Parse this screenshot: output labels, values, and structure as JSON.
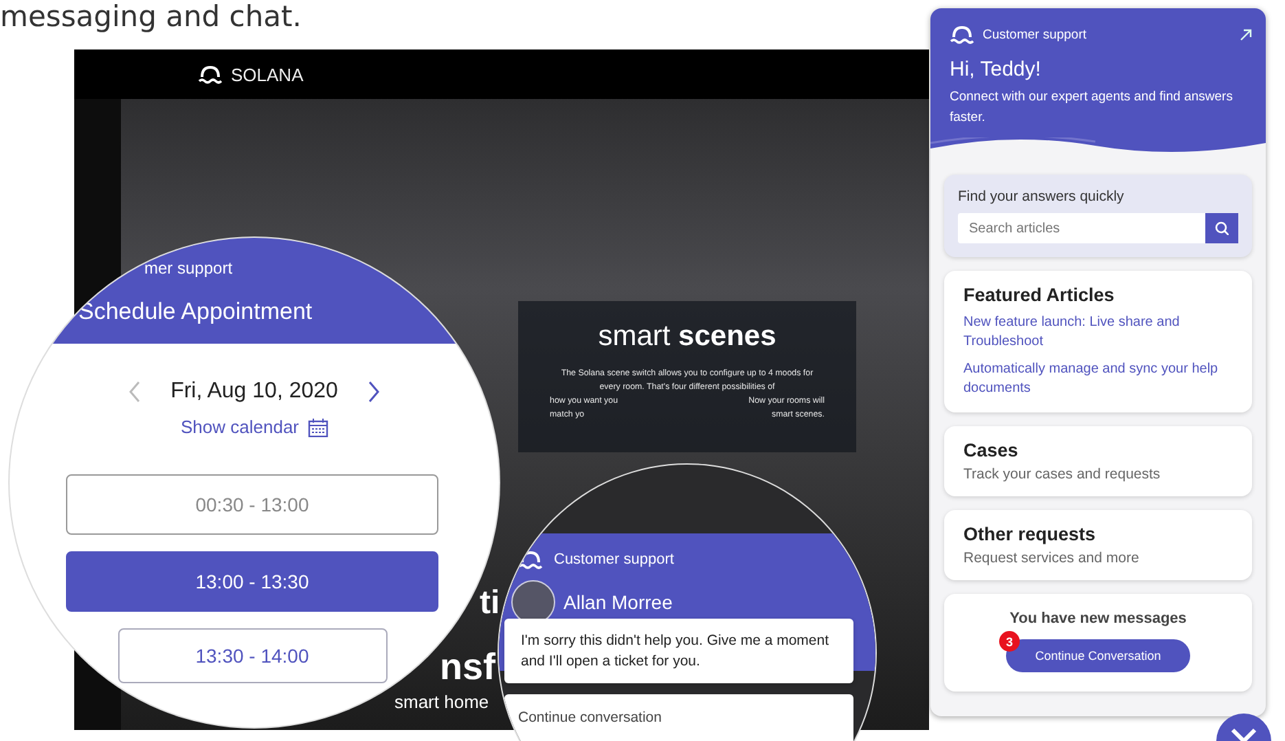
{
  "intro": {
    "text": "messaging and chat."
  },
  "site": {
    "brand": "SOLANA",
    "feature": {
      "title_light": "smart",
      "title_bold": "scenes",
      "text": "The Solana scene switch allows you to configure up to 4 moods for every room. That's four different possibilities of",
      "fragments": [
        [
          "how you want you",
          "Now your rooms will"
        ],
        [
          "match yo",
          "smart scenes."
        ]
      ]
    },
    "hero_fragments": [
      "ti",
      "nsf",
      "smart home"
    ]
  },
  "schedule": {
    "header": "mer support",
    "title": "Schedule Appointment",
    "date": "Fri, Aug 10, 2020",
    "show_calendar": "Show calendar",
    "slots": [
      {
        "label": "00:30 - 13:00",
        "selected": false,
        "disabled": true
      },
      {
        "label": "13:00 - 13:30",
        "selected": true,
        "disabled": false
      },
      {
        "label": "13:30 - 14:00",
        "selected": false,
        "disabled": false
      }
    ]
  },
  "chat": {
    "header": "Customer support",
    "agent": "Allan Morree",
    "message": "I'm sorry this didn't help you. Give me a moment and I'll open a ticket for you.",
    "continue": "Continue conversation"
  },
  "panel": {
    "header": "Customer support",
    "greeting": "Hi, Teddy!",
    "subtitle": "Connect with our expert agents and find answers faster.",
    "search": {
      "label": "Find your answers quickly",
      "placeholder": "Search articles"
    },
    "featured": {
      "title": "Featured Articles",
      "links": [
        "New feature launch: Live share and Troubleshoot",
        "Automatically manage and sync your help documents"
      ]
    },
    "cards": [
      {
        "title": "Cases",
        "subtitle": "Track your cases and requests"
      },
      {
        "title": "Other requests",
        "subtitle": "Request services and more"
      }
    ],
    "messages": {
      "title": "You have new messages",
      "button": "Continue Conversation",
      "badge": "3"
    }
  }
}
